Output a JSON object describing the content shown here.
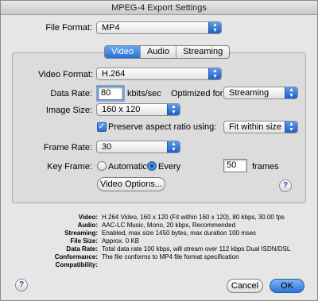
{
  "window": {
    "title": "MPEG-4 Export Settings"
  },
  "file_format": {
    "label": "File Format:",
    "value": "MP4"
  },
  "tabs": [
    "Video",
    "Audio",
    "Streaming"
  ],
  "video": {
    "format_label": "Video Format:",
    "format_value": "H.264",
    "data_rate_label": "Data Rate:",
    "data_rate_value": "80",
    "data_rate_unit": "kbits/sec",
    "optimized_label": "Optimized for:",
    "optimized_value": "Streaming",
    "image_size_label": "Image Size:",
    "image_size_value": "160 x 120",
    "preserve_label": "Preserve aspect ratio using:",
    "preserve_value": "Fit within size",
    "frame_rate_label": "Frame Rate:",
    "frame_rate_value": "30",
    "key_frame_label": "Key Frame:",
    "key_automatic": "Automatic",
    "key_every": "Every",
    "key_frames_value": "50",
    "key_frames_unit": "frames",
    "options_button": "Video Options..."
  },
  "summary": [
    {
      "label": "Video:",
      "value": "H.264 Video, 160 x 120 (Fit within 160 x 120), 80 kbps, 30.00 fps"
    },
    {
      "label": "Audio:",
      "value": "AAC-LC Music, Mono, 20 kbps, Recommended"
    },
    {
      "label": "Streaming:",
      "value": "Enabled, max size 1450 bytes, max duration 100 msec"
    },
    {
      "label": "File Size:",
      "value": "Approx. 0 KB"
    },
    {
      "label": "Data Rate:",
      "value": "Total data rate 100 kbps, will stream over 112 kbps Dual ISDN/DSL"
    },
    {
      "label": "Conformance:",
      "value": "The file conforms to MP4 file format specification"
    },
    {
      "label": "Compatibility:",
      "value": ""
    }
  ],
  "buttons": {
    "cancel": "Cancel",
    "ok": "OK",
    "help": "?"
  }
}
